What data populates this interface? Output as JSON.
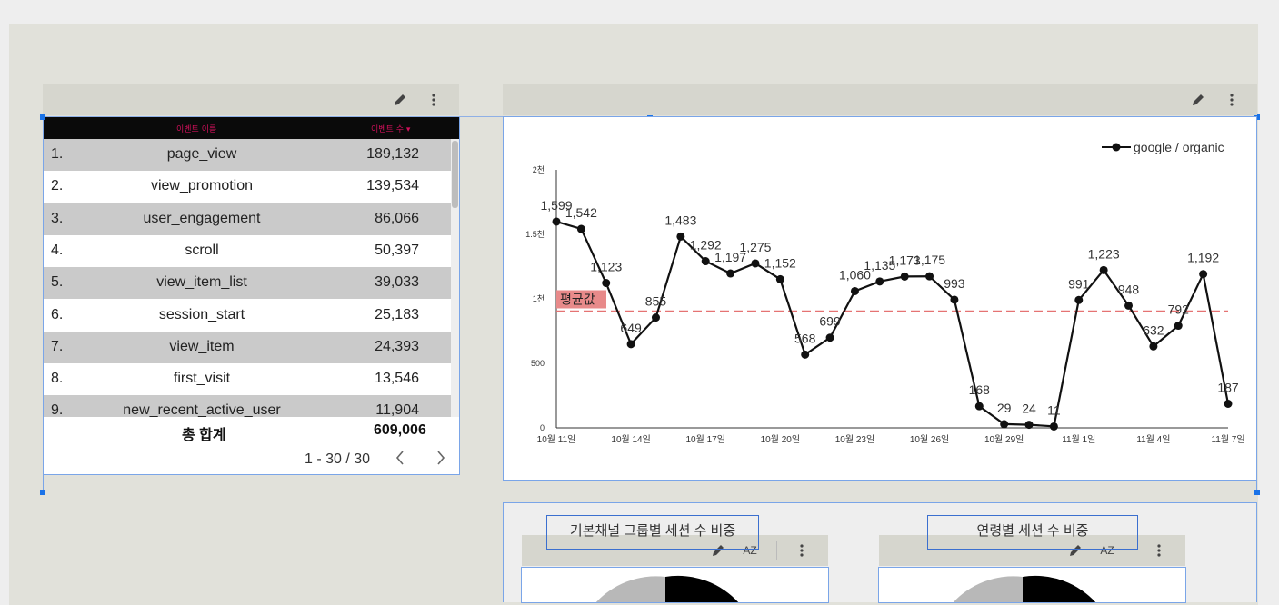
{
  "table": {
    "header": {
      "name": "이벤트 이름",
      "count": "이벤트 수 ▾"
    },
    "rows": [
      {
        "idx": "1.",
        "name": "page_view",
        "value": "189,132"
      },
      {
        "idx": "2.",
        "name": "view_promotion",
        "value": "139,534"
      },
      {
        "idx": "3.",
        "name": "user_engagement",
        "value": "86,066"
      },
      {
        "idx": "4.",
        "name": "scroll",
        "value": "50,397"
      },
      {
        "idx": "5.",
        "name": "view_item_list",
        "value": "39,033"
      },
      {
        "idx": "6.",
        "name": "session_start",
        "value": "25,183"
      },
      {
        "idx": "7.",
        "name": "view_item",
        "value": "24,393"
      },
      {
        "idx": "8.",
        "name": "first_visit",
        "value": "13,546"
      },
      {
        "idx": "9.",
        "name": "new_recent_active_user",
        "value": "11,904"
      }
    ],
    "total_label": "총 합계",
    "total_value": "609,006",
    "pager": "1 - 30 / 30",
    "prev_icon": "chevron-left-icon",
    "next_icon": "chevron-right-icon"
  },
  "toolbar": {
    "edit_icon": "pencil-icon",
    "more_icon": "more-vert-icon",
    "sort_icon": "sort-az-icon",
    "sort_label": "AZ"
  },
  "line_chart": {
    "legend": "google / organic",
    "avg_label": "평균값"
  },
  "pie1": {
    "title": "기본채널 그룹별 세션 수 비중"
  },
  "pie2": {
    "title": "연령별 세션 수 비중"
  },
  "chart_data": {
    "type": "line",
    "x": [
      "10월 11일",
      "10월 12일",
      "10월 13일",
      "10월 14일",
      "10월 15일",
      "10월 16일",
      "10월 17일",
      "10월 18일",
      "10월 19일",
      "10월 20일",
      "10월 21일",
      "10월 22일",
      "10월 23일",
      "10월 24일",
      "10월 25일",
      "10월 26일",
      "10월 27일",
      "10월 28일",
      "10월 29일",
      "10월 30일",
      "10월 31일",
      "11월 1일",
      "11월 2일",
      "11월 3일",
      "11월 4일",
      "11월 5일",
      "11월 6일",
      "11월 7일"
    ],
    "xticks": [
      "10월 11일",
      "10월 14일",
      "10월 17일",
      "10월 20일",
      "10월 23일",
      "10월 26일",
      "10월 29일",
      "11월 1일",
      "11월 4일",
      "11월 7일"
    ],
    "series": [
      {
        "name": "google / organic",
        "values": [
          1599,
          1542,
          1123,
          649,
          855,
          1483,
          1292,
          1197,
          1275,
          1152,
          568,
          699,
          1060,
          1135,
          1173,
          1175,
          993,
          168,
          29,
          24,
          11,
          991,
          1223,
          948,
          632,
          792,
          1192,
          187
        ],
        "labels": [
          "1,599",
          "1,542",
          "1,123",
          "649",
          "855",
          "1,483",
          "1,292",
          "1,197",
          "1,275",
          "1,152",
          "568",
          "699",
          "1,060",
          "1,135",
          "1,173",
          "1,175",
          "993",
          "168",
          "29",
          "24",
          "11",
          "991",
          "1,223",
          "948",
          "632",
          "792",
          "1,192",
          "187"
        ]
      }
    ],
    "yticks": [
      {
        "v": 0,
        "label": "0"
      },
      {
        "v": 500,
        "label": "500"
      },
      {
        "v": 1000,
        "label": "1천"
      },
      {
        "v": 1500,
        "label": "1.5천"
      },
      {
        "v": 2000,
        "label": "2천"
      }
    ],
    "ylim": [
      0,
      2000
    ],
    "average": 905,
    "colors": {
      "line": "#111111",
      "avg": "#e57373"
    },
    "legend_position": "top-right"
  }
}
